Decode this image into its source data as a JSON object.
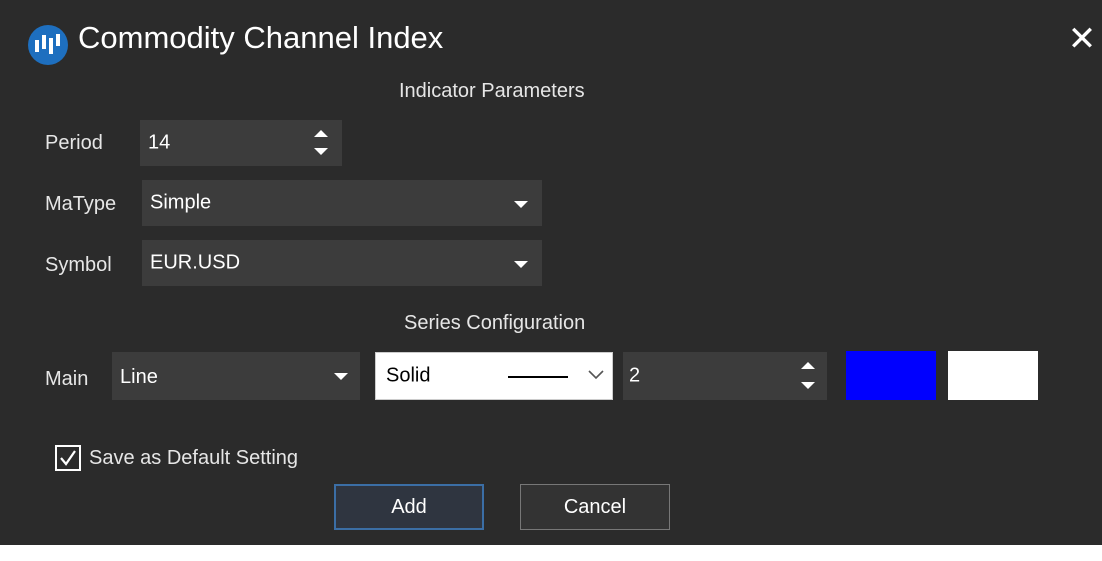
{
  "window": {
    "title": "Commodity Channel Index"
  },
  "sections": {
    "indicator_parameters": "Indicator Parameters",
    "series_configuration": "Series Configuration"
  },
  "params": {
    "period": {
      "label": "Period",
      "value": "14"
    },
    "matype": {
      "label": "MaType",
      "value": "Simple"
    },
    "symbol": {
      "label": "Symbol",
      "value": "EUR.USD"
    }
  },
  "series": {
    "main": {
      "label": "Main",
      "type": "Line",
      "line_style": "Solid",
      "width": "2",
      "color_primary": "#0000ff",
      "color_secondary": "#ffffff"
    }
  },
  "save_default": {
    "label": "Save as Default Setting",
    "checked": true
  },
  "buttons": {
    "add": "Add",
    "cancel": "Cancel"
  },
  "icons": {
    "app": "app-logo-icon",
    "close": "close-icon",
    "dropdown": "chevron-down-icon",
    "spin": "spin-arrows-icon",
    "check": "checkmark-icon"
  }
}
